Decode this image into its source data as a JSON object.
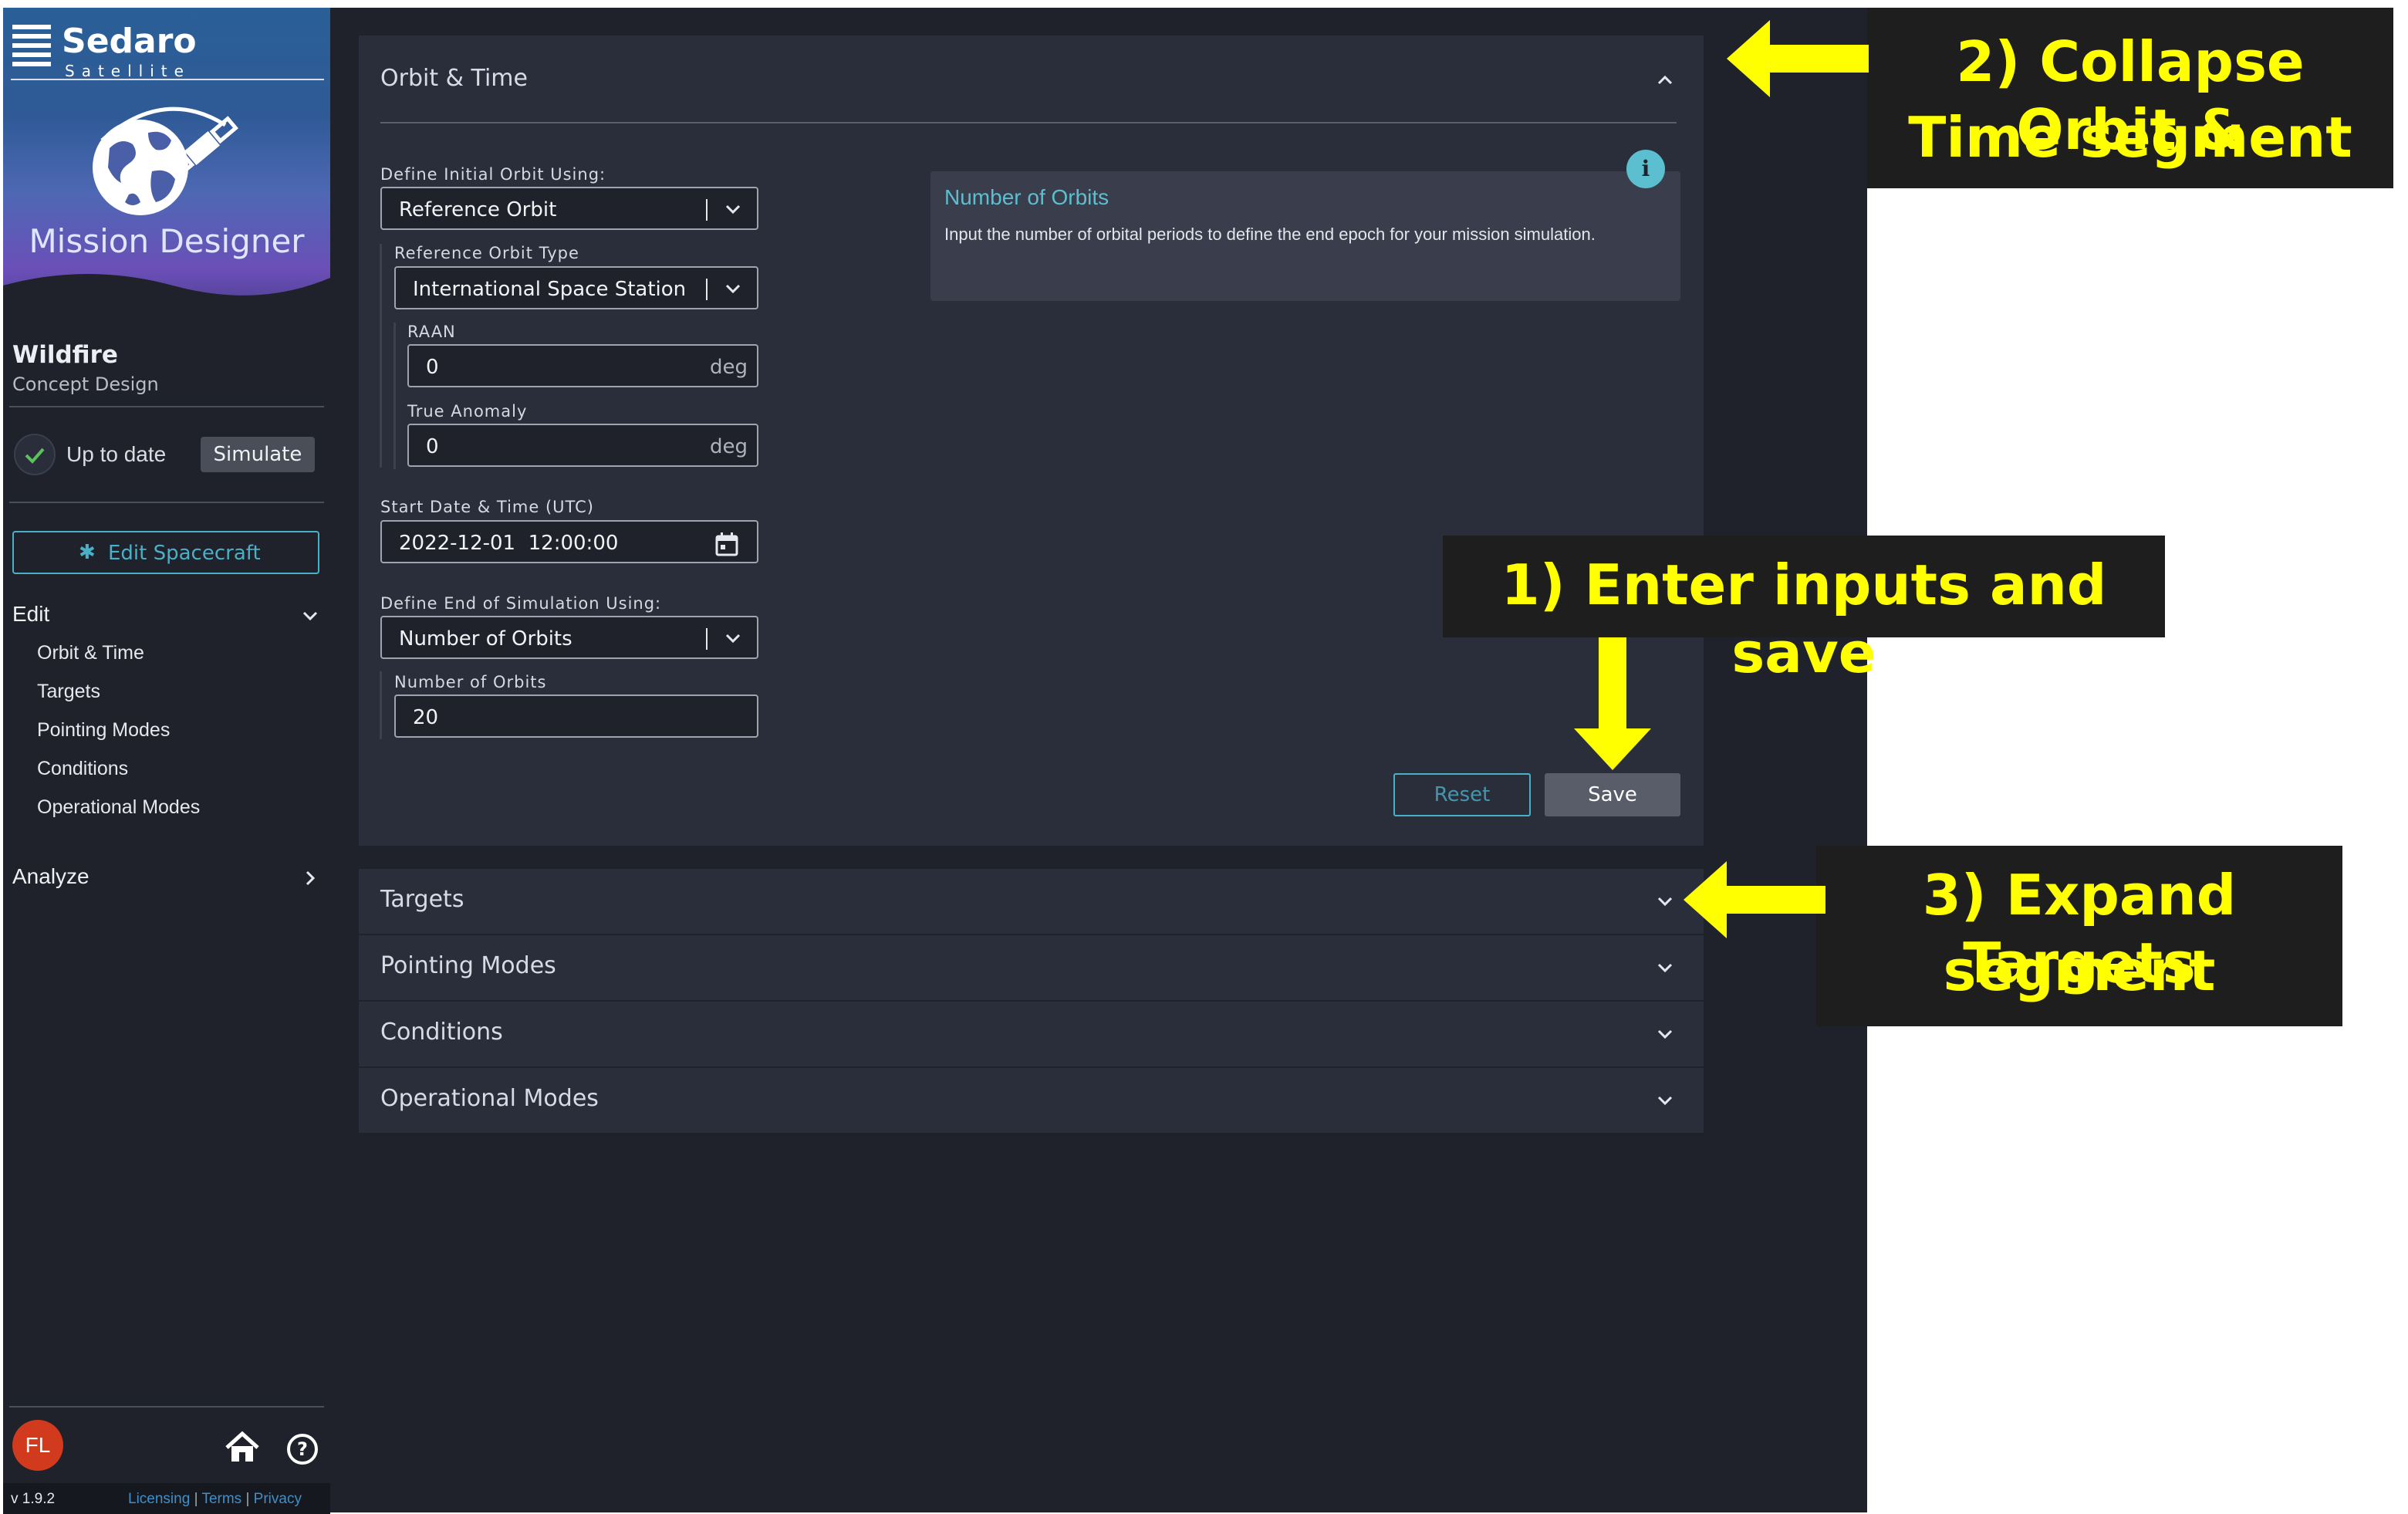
{
  "sidebar": {
    "brand_name": "Sedaro",
    "brand_sub": "Satellite",
    "app_title": "Mission Designer",
    "project_name": "Wildfire",
    "project_sub": "Concept Design",
    "status_label": "Up to date",
    "simulate_label": "Simulate",
    "edit_spacecraft_label": "Edit Spacecraft",
    "edit_section_label": "Edit",
    "edit_items": [
      "Orbit & Time",
      "Targets",
      "Pointing Modes",
      "Conditions",
      "Operational Modes"
    ],
    "analyze_label": "Analyze",
    "avatar_initials": "FL",
    "version": "v 1.9.2",
    "footer_links": {
      "licensing": "Licensing",
      "sep1": "|",
      "terms": "Terms",
      "sep2": "|",
      "privacy": "Privacy"
    }
  },
  "orbit_time": {
    "title": "Orbit & Time",
    "initial_orbit_label": "Define Initial Orbit Using:",
    "initial_orbit_value": "Reference Orbit",
    "ref_orbit_type_label": "Reference Orbit Type",
    "ref_orbit_type_value": "International Space Station",
    "raan_label": "RAAN",
    "raan_value": "0",
    "raan_unit": "deg",
    "true_anomaly_label": "True Anomaly",
    "true_anomaly_value": "0",
    "true_anomaly_unit": "deg",
    "start_label": "Start Date & Time (UTC)",
    "start_value": "2022-12-01  12:00:00",
    "end_label": "Define End of Simulation Using:",
    "end_value": "Number of Orbits",
    "num_orbits_label": "Number of Orbits",
    "num_orbits_value": "20",
    "info_title": "Number of Orbits",
    "info_body": "Input the number of orbital periods to define the end epoch for your mission simulation.",
    "reset_label": "Reset",
    "save_label": "Save"
  },
  "segments": [
    "Targets",
    "Pointing Modes",
    "Conditions",
    "Operational Modes"
  ],
  "annotations": {
    "step1": "1) Enter inputs and save",
    "step2_line1": "2) Collapse Orbit &",
    "step2_line2": "Time segment",
    "step3_line1": "3) Expand Targets",
    "step3_line2": "segment"
  },
  "colors": {
    "accent_teal": "#5cbfcf",
    "annotation_yellow": "#ffff00",
    "avatar_red": "#d23a1e"
  }
}
